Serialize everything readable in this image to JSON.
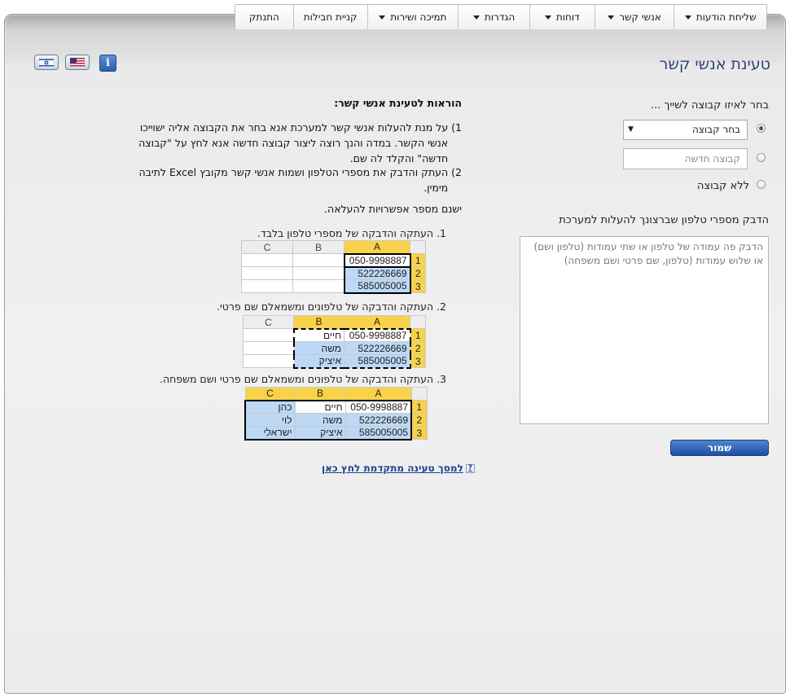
{
  "nav": {
    "items": [
      {
        "label": "שליחת הודעות",
        "dropdown": true
      },
      {
        "label": "אנשי קשר",
        "dropdown": true
      },
      {
        "label": "דוחות",
        "dropdown": true
      },
      {
        "label": "הגדרות",
        "dropdown": true
      },
      {
        "label": "תמיכה ושירות",
        "dropdown": true
      },
      {
        "label": "קניית חבילות",
        "dropdown": false
      },
      {
        "label": "התנתק",
        "dropdown": false
      }
    ]
  },
  "page": {
    "title": "טעינת אנשי קשר"
  },
  "form": {
    "group_label": "בחר לאיזו קבוצה לשייך ...",
    "select_group": "בחר קבוצה",
    "new_group_placeholder": "קבוצה חדשה",
    "no_group": "ללא קבוצה",
    "paste_label": "הדבק מספרי טלפון שברצונך להעלות למערכת",
    "paste_placeholder": "הדבק פה עמודה של טלפון או שתי עמודות (טלפון ושם) או שלוש עמודות (טלפון, שם פרטי ושם משפחה)",
    "save": "שמור"
  },
  "instructions": {
    "title": "הוראות לטעינת אנשי קשר:",
    "step1_num": "1)",
    "step1": "על מנת להעלות אנשי קשר למערכת אנא בחר את הקבוצה אליה ישוייכו אנשי הקשר. במדה והנך רוצה ליצור קבוצה חדשה אנא לחץ על \"קבוצה חדשה\" והקלד לה שם.",
    "step2_num": "2)",
    "step2": "העתק והדבק את מספרי הטלפון ושמות אנשי קשר מקובץ Excel לתיבה מימין.",
    "options_intro": "ישנם מספר אפשרויות להעלאה.",
    "opt1": "1.  העתקה והדבקה של מספרי טלפון בלבד.",
    "opt2": "2.  העתקה והדבקה של טלפונים ומשמאלם שם פרטי.",
    "opt3": "3.  העתקה והדבקה של טלפונים ומשמאלם שם פרטי ושם משפחה.",
    "advanced_link": "למסך טעינה מתקדמת לחץ כאן",
    "help_mark": "?"
  },
  "excel": {
    "cols": [
      "A",
      "B",
      "C"
    ],
    "rows": [
      "1",
      "2",
      "3"
    ],
    "phones": [
      "050-9998887",
      "522226669",
      "585005005"
    ],
    "first_names": [
      "חיים",
      "משה",
      "איציק"
    ],
    "last_names": [
      "כהן",
      "לוי",
      "ישראלי"
    ]
  },
  "icons": {
    "lang_he": "israel-flag-icon",
    "lang_en": "us-flag-icon",
    "info": "info-icon"
  },
  "colors": {
    "title": "#2e4477",
    "save_button": "#2b5fb0",
    "excel_highlight": "#f7d24a",
    "excel_selection": "#bcd8f5"
  }
}
